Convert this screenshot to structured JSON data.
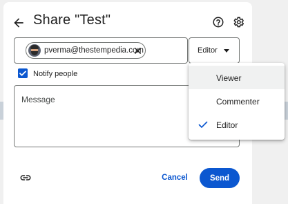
{
  "dialog": {
    "title": "Share \"Test\"",
    "icons": {
      "back": "back-arrow-icon",
      "help": "help-icon",
      "settings": "gear-icon",
      "link": "link-icon"
    }
  },
  "recipients": {
    "chips": [
      {
        "email": "pverma@thestempedia.com"
      }
    ]
  },
  "role_select": {
    "value": "Editor",
    "options": [
      {
        "label": "Viewer",
        "checked": false
      },
      {
        "label": "Commenter",
        "checked": false
      },
      {
        "label": "Editor",
        "checked": true
      }
    ]
  },
  "notify": {
    "label": "Notify people",
    "checked": true
  },
  "message": {
    "placeholder": "Message"
  },
  "actions": {
    "cancel_label": "Cancel",
    "send_label": "Send"
  },
  "colors": {
    "accent": "#0b57d0",
    "text": "#1f1f1f",
    "border": "#747775"
  }
}
